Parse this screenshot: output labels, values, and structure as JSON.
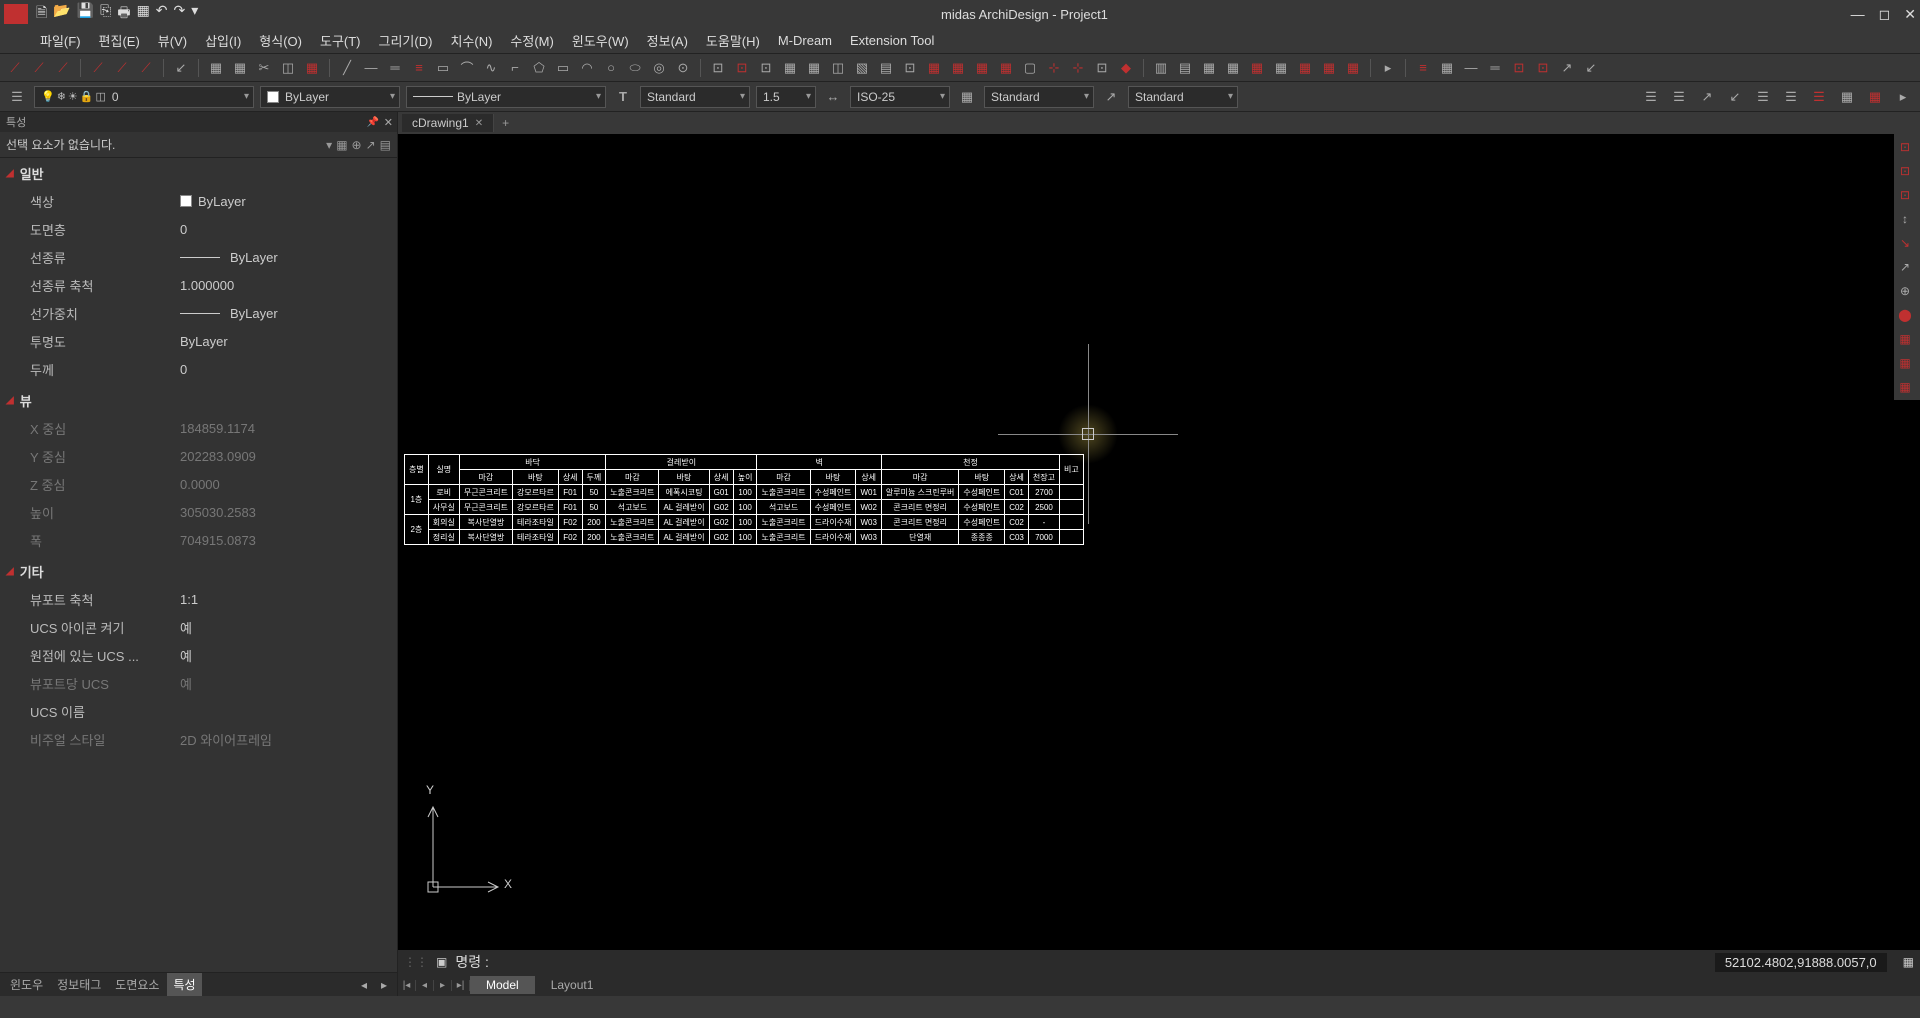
{
  "title": "midas ArchiDesign - Project1",
  "menubar": [
    "파일(F)",
    "편집(E)",
    "뷰(V)",
    "삽입(I)",
    "형식(O)",
    "도구(T)",
    "그리기(D)",
    "치수(N)",
    "수정(M)",
    "윈도우(W)",
    "정보(A)",
    "도움말(H)",
    "M-Dream",
    "Extension Tool"
  ],
  "layer_current": "0",
  "combo_color": "ByLayer",
  "combo_linetype": "ByLayer",
  "combo_textstyle": "Standard",
  "combo_dimscale": "1.5",
  "combo_dimstyle": "ISO-25",
  "combo_tablestyle": "Standard",
  "combo_mleader": "Standard",
  "doc_tab": "cDrawing1",
  "props": {
    "header": "특성",
    "selection": "선택 요소가 없습니다.",
    "sections": {
      "general": "일반",
      "view": "뷰",
      "misc": "기타"
    },
    "rows": {
      "color_label": "색상",
      "color_value": "ByLayer",
      "layer_label": "도면층",
      "layer_value": "0",
      "ltype_label": "선종류",
      "ltype_value": "ByLayer",
      "ltscale_label": "선종류 축척",
      "ltscale_value": "1.000000",
      "lweight_label": "선가중치",
      "lweight_value": "ByLayer",
      "transp_label": "투명도",
      "transp_value": "ByLayer",
      "thick_label": "두께",
      "thick_value": "0",
      "cx_label": "X 중심",
      "cx_value": "184859.1174",
      "cy_label": "Y 중심",
      "cy_value": "202283.0909",
      "cz_label": "Z 중심",
      "cz_value": "0.0000",
      "h_label": "높이",
      "h_value": "305030.2583",
      "w_label": "폭",
      "w_value": "704915.0873",
      "vpscale_label": "뷰포트 축척",
      "vpscale_value": "1:1",
      "ucsicon_label": "UCS 아이콘 켜기",
      "ucsicon_value": "예",
      "ucsorigin_label": "원점에 있는 UCS ...",
      "ucsorigin_value": "예",
      "ucsvp_label": "뷰포트당 UCS",
      "ucsvp_value": "예",
      "ucsname_label": "UCS 이름",
      "ucsname_value": "",
      "vstyle_label": "비주얼 스타일",
      "vstyle_value": "2D 와이어프레임"
    },
    "tabs": [
      "윈도우",
      "정보태그",
      "도면요소",
      "특성"
    ]
  },
  "drawing_table": {
    "group_headers": [
      "바닥",
      "걸레받이",
      "벽",
      "천정",
      "비고"
    ],
    "sub_headers": [
      "마감",
      "바탕",
      "상세",
      "두께",
      "마감",
      "바탕",
      "상세",
      "높이",
      "마감",
      "바탕",
      "상세",
      "마감",
      "바탕",
      "상세",
      "천장고"
    ],
    "row_labels": [
      "층별",
      "실명"
    ],
    "floors": [
      "1층",
      "2층"
    ],
    "rows": [
      [
        "로비",
        "무근콘크리트",
        "강모르타르",
        "F01",
        "50",
        "노출콘크리트",
        "에폭시코팅",
        "G01",
        "100",
        "노출콘크리트",
        "수성페인트",
        "W01",
        "알루미늄 스크린루버",
        "수성페인트",
        "C01",
        "2700"
      ],
      [
        "사무실",
        "무근콘크리트",
        "강모르타르",
        "F01",
        "50",
        "석고보드",
        "AL 걸레받이",
        "G02",
        "100",
        "석고보드",
        "수성페인트",
        "W02",
        "콘크리트 면정리",
        "수성페인트",
        "C02",
        "2500"
      ],
      [
        "회의실",
        "복사단열방",
        "테라조타일",
        "F02",
        "200",
        "노출콘크리트",
        "AL 걸레받이",
        "G02",
        "100",
        "노출콘크리트",
        "드라이수재",
        "W03",
        "콘크리트 면정리",
        "수성페인트",
        "C02",
        "-"
      ],
      [
        "정리실",
        "복사단열방",
        "테라조타일",
        "F02",
        "200",
        "노출콘크리트",
        "AL 걸레받이",
        "G02",
        "100",
        "노출콘크리트",
        "드라이수재",
        "W03",
        "단열재",
        "종종종",
        "C03",
        "7000"
      ]
    ]
  },
  "command_prompt": "명령 :",
  "coords": "52102.4802,91888.0057,0",
  "model_tabs": [
    "Model",
    "Layout1"
  ]
}
